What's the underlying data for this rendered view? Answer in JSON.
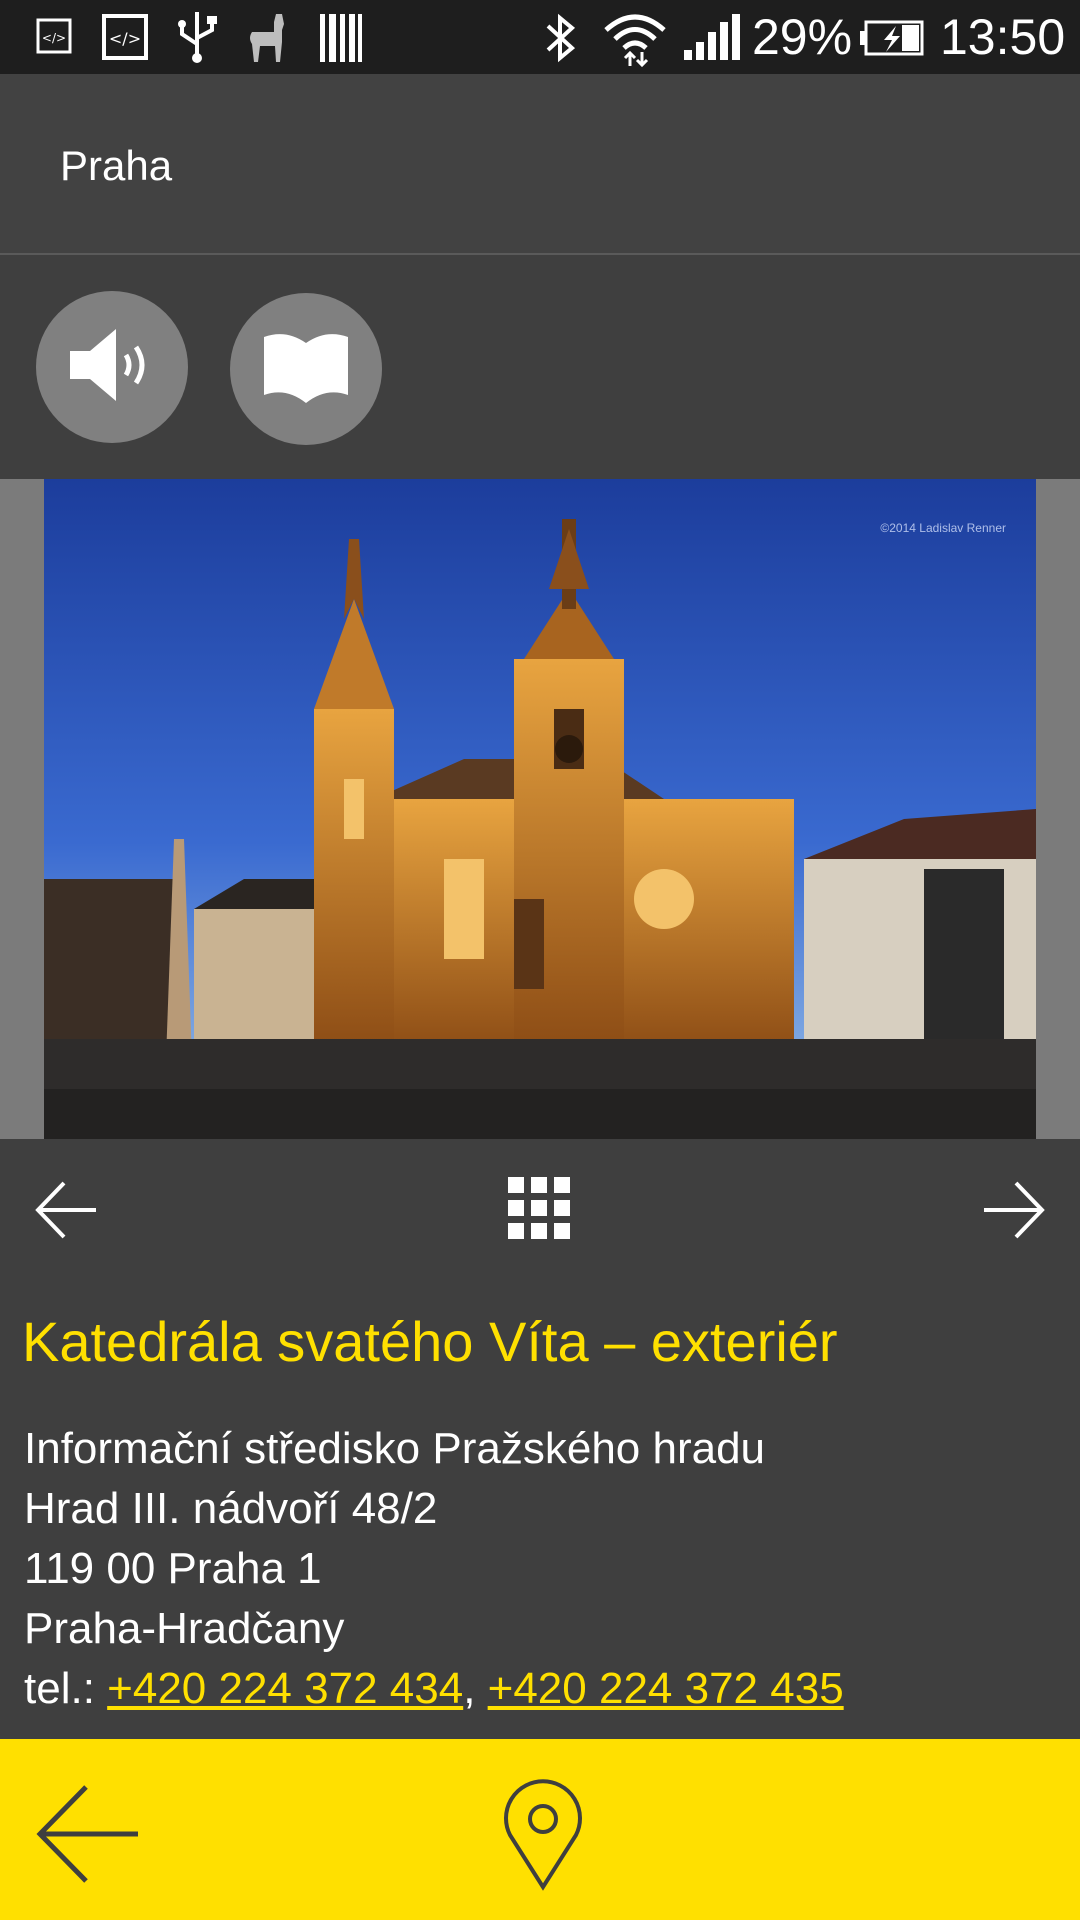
{
  "status_bar": {
    "battery_percent": "29%",
    "time": "13:50",
    "icons": [
      "dev-tools-icon",
      "code-icon",
      "usb-icon",
      "llama-icon",
      "barcode-icon",
      "bluetooth-icon",
      "wifi-icon",
      "signal-icon",
      "battery-charging-icon"
    ]
  },
  "header": {
    "title": "Praha"
  },
  "media": {
    "buttons": [
      "speaker-icon",
      "book-icon"
    ]
  },
  "photo": {
    "credit": "©2014 Ladislav Renner"
  },
  "nav": {
    "icons": [
      "arrow-left-icon",
      "grid-icon",
      "arrow-right-icon"
    ]
  },
  "poi": {
    "title": "Katedrála svatého Víta – exteriér",
    "address_lines": [
      "Informační středisko Pražského hradu",
      "Hrad III. nádvoří 48/2",
      "119 00 Praha 1",
      "Praha-Hradčany"
    ],
    "tel_label": "tel.: ",
    "phones": [
      "+420 224 372 434",
      "+420 224 372 435"
    ],
    "phone_separator": ", "
  },
  "bottom_bar": {
    "icons": [
      "back-arrow-icon",
      "map-pin-icon"
    ]
  },
  "colors": {
    "accent": "#ffe000",
    "background": "#3f3f3f",
    "header": "#424242",
    "status_bar": "#1e1e1e"
  }
}
